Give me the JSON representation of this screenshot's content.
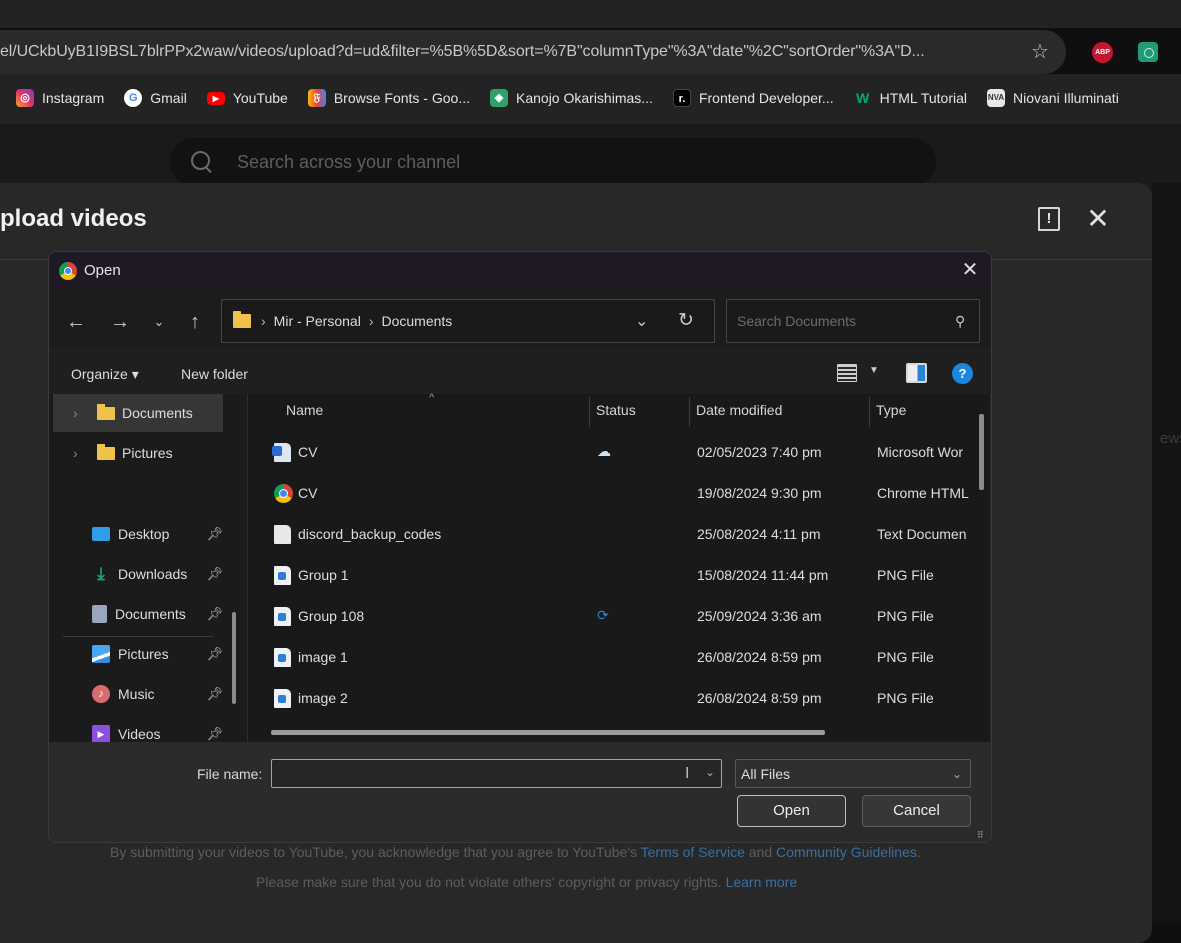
{
  "browser": {
    "url": "el/UCkbUyB1I9BSL7blrPPx2waw/videos/upload?d=ud&filter=%5B%5D&sort=%7B\"columnType\"%3A\"date\"%2C\"sortOrder\"%3A\"D...",
    "bookmark_star_icon": "star-icon",
    "extensions": [
      {
        "name": "AdBlock Plus",
        "badge": "ABP",
        "color": "#c2172f"
      },
      {
        "name": "ChatGPT",
        "color": "#1f9b76"
      }
    ],
    "bookmarks": [
      {
        "label": "Instagram",
        "icon": "instagram-icon"
      },
      {
        "label": "Gmail",
        "icon": "google-icon"
      },
      {
        "label": "YouTube",
        "icon": "youtube-icon"
      },
      {
        "label": "Browse Fonts - Goo...",
        "icon": "google-fonts-icon"
      },
      {
        "label": "Kanojo Okarishimas...",
        "icon": "site-icon"
      },
      {
        "label": "Frontend Developer...",
        "icon": "frontend-mentor-icon"
      },
      {
        "label": "HTML Tutorial",
        "icon": "w3schools-icon"
      },
      {
        "label": "Niovani Illuminati",
        "icon": "niovani-icon"
      }
    ]
  },
  "studio": {
    "search_placeholder": "Search across your channel",
    "modal_title": "pload videos",
    "side_text": "ews",
    "legal_line1_prefix": "By submitting your videos to YouTube, you acknowledge that you agree to YouTube's ",
    "terms_link": "Terms of Service",
    "and_text": " and ",
    "guidelines_link": "Community Guidelines",
    "period": ".",
    "legal_line2_prefix": "Please make sure that you do not violate others' copyright or privacy rights. ",
    "learn_more_link": "Learn more"
  },
  "dialog": {
    "title": "Open",
    "path": [
      "Mir - Personal",
      "Documents"
    ],
    "search_placeholder": "Search Documents",
    "organize_label": "Organize ▾",
    "new_folder_label": "New folder",
    "help_label": "?",
    "nav_tree": [
      {
        "label": "Documents",
        "selected": true
      },
      {
        "label": "Pictures",
        "selected": false
      }
    ],
    "quick_access": [
      {
        "label": "Desktop",
        "icon": "desktop-icon",
        "color": "#2f9ee6",
        "pinned": true
      },
      {
        "label": "Downloads",
        "icon": "download-icon",
        "color": "#1aa37a",
        "pinned": true
      },
      {
        "label": "Documents",
        "icon": "documents-icon",
        "color": "#9aa6bb",
        "pinned": true
      },
      {
        "label": "Pictures",
        "icon": "pictures-icon",
        "color": "#2f8ee0",
        "pinned": true
      },
      {
        "label": "Music",
        "icon": "music-icon",
        "color": "#d86b6b",
        "pinned": true
      },
      {
        "label": "Videos",
        "icon": "videos-icon",
        "color": "#8c4fe0",
        "pinned": true
      }
    ],
    "columns": [
      "Name",
      "Status",
      "Date modified",
      "Type"
    ],
    "files": [
      {
        "name": "CV",
        "icon": "word-doc-icon",
        "status": "cloud",
        "date": "02/05/2023 7:40 pm",
        "type": "Microsoft Wor"
      },
      {
        "name": "CV",
        "icon": "chrome-html-icon",
        "status": "",
        "date": "19/08/2024 9:30 pm",
        "type": "Chrome HTML"
      },
      {
        "name": "discord_backup_codes",
        "icon": "text-file-icon",
        "status": "",
        "date": "25/08/2024 4:11 pm",
        "type": "Text Documen"
      },
      {
        "name": "Group 1",
        "icon": "png-file-icon",
        "status": "",
        "date": "15/08/2024 11:44 pm",
        "type": "PNG File"
      },
      {
        "name": "Group 108",
        "icon": "png-file-icon",
        "status": "sync",
        "date": "25/09/2024 3:36 am",
        "type": "PNG File"
      },
      {
        "name": "image 1",
        "icon": "png-file-icon",
        "status": "",
        "date": "26/08/2024 8:59 pm",
        "type": "PNG File"
      },
      {
        "name": "image 2",
        "icon": "png-file-icon",
        "status": "",
        "date": "26/08/2024 8:59 pm",
        "type": "PNG File"
      }
    ],
    "file_name_label": "File name:",
    "file_name_value": "",
    "file_type_filter": "All Files",
    "open_button": "Open",
    "cancel_button": "Cancel"
  }
}
